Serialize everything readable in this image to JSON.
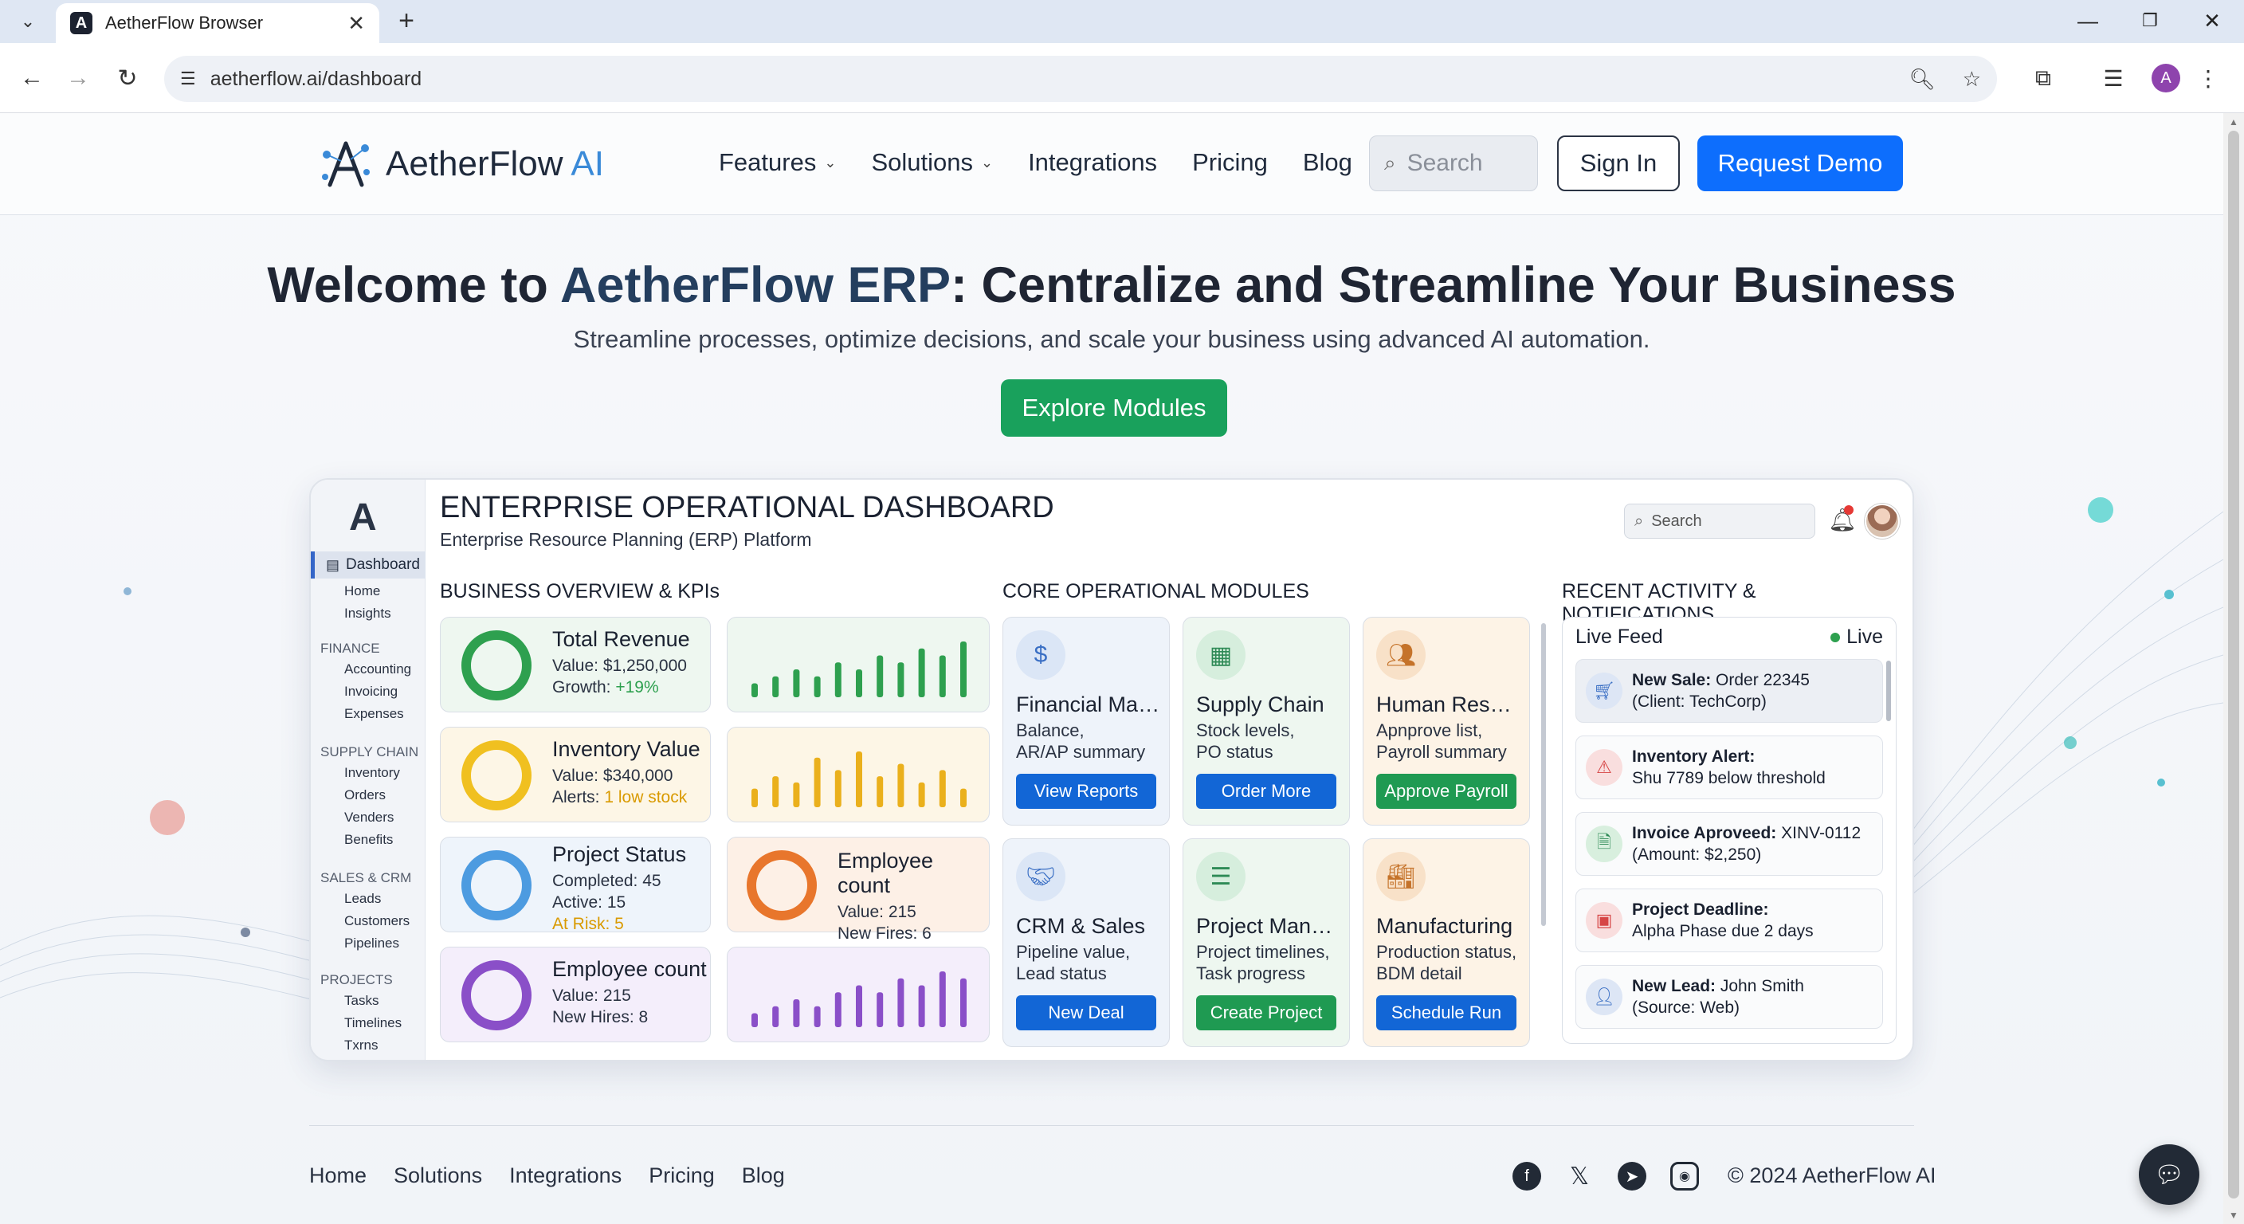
{
  "browser": {
    "tab_title": "AetherFlow Browser",
    "tab_favicon": "A",
    "url": "aetherflow.ai/dashboard",
    "profile_initial": "A"
  },
  "site": {
    "logo_text": "AetherFlow",
    "logo_ai": "AI",
    "nav": [
      {
        "label": "Features",
        "has_dropdown": true
      },
      {
        "label": "Solutions",
        "has_dropdown": true
      },
      {
        "label": "Integrations",
        "has_dropdown": false
      },
      {
        "label": "Pricing",
        "has_dropdown": false
      },
      {
        "label": "Blog",
        "has_dropdown": false
      }
    ],
    "search_placeholder": "Search",
    "signin_label": "Sign In",
    "demo_label": "Request Demo"
  },
  "hero": {
    "title_prefix": "Welcome to",
    "title_brand": "AetherFlow ERP",
    "title_suffix": ": Centralize and Streamline Your Business",
    "subtitle": "Streamline processes, optimize decisions, and scale your business using advanced AI automation.",
    "cta_label": "Explore Modules"
  },
  "dashboard": {
    "logo": "A",
    "title": "ENTERPRISE OPERATIONAL DASHBOARD",
    "subtitle": "Enterprise Resource Planning (ERP) Platform",
    "search_placeholder": "Search",
    "notification_count": "1",
    "sidebar": {
      "active": "Dashboard",
      "top_items": [
        "Home",
        "Insights"
      ],
      "groups": [
        {
          "name": "FINANCE",
          "items": [
            "Accounting",
            "Invoicing",
            "Expenses"
          ]
        },
        {
          "name": "SUPPLY CHAIN",
          "items": [
            "Inventory",
            "Orders",
            "Venders",
            "Benefits"
          ]
        },
        {
          "name": "SALES & CRM",
          "items": [
            "Leads",
            "Customers",
            "Pipelines"
          ]
        },
        {
          "name": "PROJECTS",
          "items": [
            "Tasks",
            "Timelines",
            "Txrns"
          ]
        }
      ]
    },
    "sections": {
      "kpis": "BUSINESS OVERVIEW & KPIs",
      "modules": "CORE OPERATIONAL MODULES",
      "activity": "RECENT ACTIVITY & NOTIFICATIONS"
    },
    "kpis": [
      {
        "name": "Total Revenue",
        "line1": "Value: $1,250,000",
        "line2_label": "Growth: ",
        "line2_value": "+19%",
        "line3": "",
        "color": "#2ea04f",
        "ring_fill": 1.0
      },
      {
        "name": "Inventory Value",
        "line1": "Value: $340,000",
        "line2_label": "Alerts: ",
        "line2_value": "1 low stock",
        "line3": "",
        "color": "#f0c020",
        "ring_fill": 1.0
      },
      {
        "name": "Project Status",
        "line1": "Completed: 45",
        "line2_label": "Active: ",
        "line2_value": "15",
        "line3": "At Risk: 5",
        "color": "#4d9be0",
        "ring_fill": 1.0
      },
      {
        "name": "Employee count",
        "line1": "Value: 215",
        "line2_label": "New Hires: ",
        "line2_value": "8",
        "line3": "",
        "color": "#8a4fc8",
        "ring_fill": 1.0
      }
    ],
    "kpi_side": {
      "name": "Employee count",
      "line1": "Value: 215",
      "line2": "New Fires: 6",
      "color": "#e8762c"
    },
    "sparks": [
      {
        "color": "#2ea04f",
        "bg": "#eef7f0",
        "values": [
          2,
          3,
          4,
          3,
          5,
          4,
          6,
          5,
          7,
          6,
          8
        ]
      },
      {
        "color": "#eab01c",
        "bg": "#fdf6e6",
        "values": [
          3,
          5,
          4,
          8,
          6,
          9,
          5,
          7,
          4,
          6,
          3
        ]
      },
      {
        "color": "#8a4fc8",
        "bg": "#f4eefb",
        "values": [
          2,
          3,
          4,
          3,
          5,
          6,
          5,
          7,
          6,
          8,
          7
        ]
      }
    ],
    "modules": [
      {
        "name": "Financial Man...",
        "desc1": "Balance,",
        "desc2": "AR/AP summary",
        "button": "View Reports",
        "icon": "dollar-icon",
        "glyph": "$",
        "icon_color": "#3a6fc4",
        "icon_bg": "#dbe6f6",
        "bg": "#eef3fa",
        "btn_color": "#1266d6"
      },
      {
        "name": "Supply Chain",
        "desc1": "Stock levels,",
        "desc2": "PO status",
        "button": "Order More",
        "icon": "boxes-icon",
        "glyph": "▦",
        "icon_color": "#2e8a56",
        "icon_bg": "#d6eedd",
        "bg": "#eef7f0",
        "btn_color": "#1266d6"
      },
      {
        "name": "Human Resou...",
        "desc1": "Apnprove list,",
        "desc2": "Payroll summary",
        "button": "Approve Payroll",
        "icon": "people-icon",
        "glyph": "👥",
        "icon_color": "#c5732a",
        "icon_bg": "#f8e1c8",
        "bg": "#fdf3e6",
        "btn_color": "#1f9a52"
      },
      {
        "name": "CRM & Sales",
        "desc1": "Pipeline value,",
        "desc2": "Lead status",
        "button": "New Deal",
        "icon": "handshake-icon",
        "glyph": "🤝",
        "icon_color": "#3a6fc4",
        "icon_bg": "#dbe6f6",
        "bg": "#eef3fa",
        "btn_color": "#1266d6"
      },
      {
        "name": "Project Manag...",
        "desc1": "Project timelines,",
        "desc2": "Task progress",
        "button": "Create Project",
        "icon": "list-icon",
        "glyph": "☰",
        "icon_color": "#2e8a56",
        "icon_bg": "#d6eedd",
        "bg": "#eef7f0",
        "btn_color": "#1f9a52"
      },
      {
        "name": "Manufacturing",
        "desc1": "Production status,",
        "desc2": "BDM detail",
        "button": "Schedule Run",
        "icon": "factory-icon",
        "glyph": "🏭",
        "icon_color": "#c5732a",
        "icon_bg": "#f8e1c8",
        "bg": "#fdf3e6",
        "btn_color": "#1266d6"
      }
    ],
    "feed": {
      "title": "Live Feed",
      "live_label": "Live",
      "items": [
        {
          "bold": "New Sale:",
          "rest": " Order 22345",
          "line2": "(Client: TechCorp)",
          "icon": "cart-icon",
          "glyph": "🛒",
          "icon_bg": "#dde6f5"
        },
        {
          "bold": "Inventory Alert:",
          "rest": "",
          "line2": "Shu 7789 below threshold",
          "icon": "warning-icon",
          "glyph": "⚠",
          "icon_bg": "#f9dede"
        },
        {
          "bold": "Invoice Aproveed:",
          "rest": " XINV-0112",
          "line2": "(Amount: $2,250)",
          "icon": "document-icon",
          "glyph": "🗎",
          "icon_bg": "#d8efde"
        },
        {
          "bold": "Project Deadline:",
          "rest": "",
          "line2": "Alpha Phase due 2 days",
          "icon": "calendar-icon",
          "glyph": "📅",
          "icon_bg": "#f9dede"
        },
        {
          "bold": "New Lead:",
          "rest": " John Smith",
          "line2": "(Source: Web)",
          "icon": "user-icon",
          "glyph": "👤",
          "icon_bg": "#dde6f5"
        }
      ]
    }
  },
  "footer": {
    "links": [
      "Home",
      "Solutions",
      "Integrations",
      "Pricing",
      "Blog"
    ],
    "social": [
      "facebook-icon",
      "x-icon",
      "telegram-icon",
      "instagram-icon"
    ],
    "copyright": "© 2024 AetherFlow AI"
  }
}
